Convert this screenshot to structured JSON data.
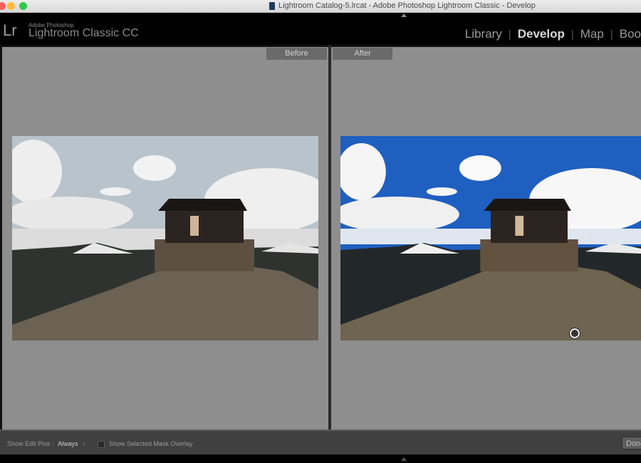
{
  "window": {
    "title": "Lightroom Catalog-5.lrcat - Adobe Photoshop Lightroom Classic - Develop",
    "controls": [
      "close",
      "minimize",
      "maximize"
    ]
  },
  "header": {
    "logo_mark": "Lr",
    "brand_small": "Adobe Photoshop",
    "brand_big": "Lightroom Classic CC",
    "modules": [
      {
        "label": "Library",
        "active": false
      },
      {
        "label": "Develop",
        "active": true
      },
      {
        "label": "Map",
        "active": false
      },
      {
        "label": "Boo",
        "active": false
      }
    ],
    "separator": "|"
  },
  "compare": {
    "before_label": "Before",
    "after_label": "After",
    "colors": {
      "before_sky": "#b7c2cc",
      "after_sky": "#1f5fc0"
    }
  },
  "toolbar": {
    "edit_pins_label": "Show Edit Pins :",
    "edit_pins_value": "Always",
    "edit_pins_arrows": "↕",
    "mask_overlay_label": "Show Selected Mask Overlay",
    "mask_overlay_checked": false,
    "done_label": "Done"
  }
}
